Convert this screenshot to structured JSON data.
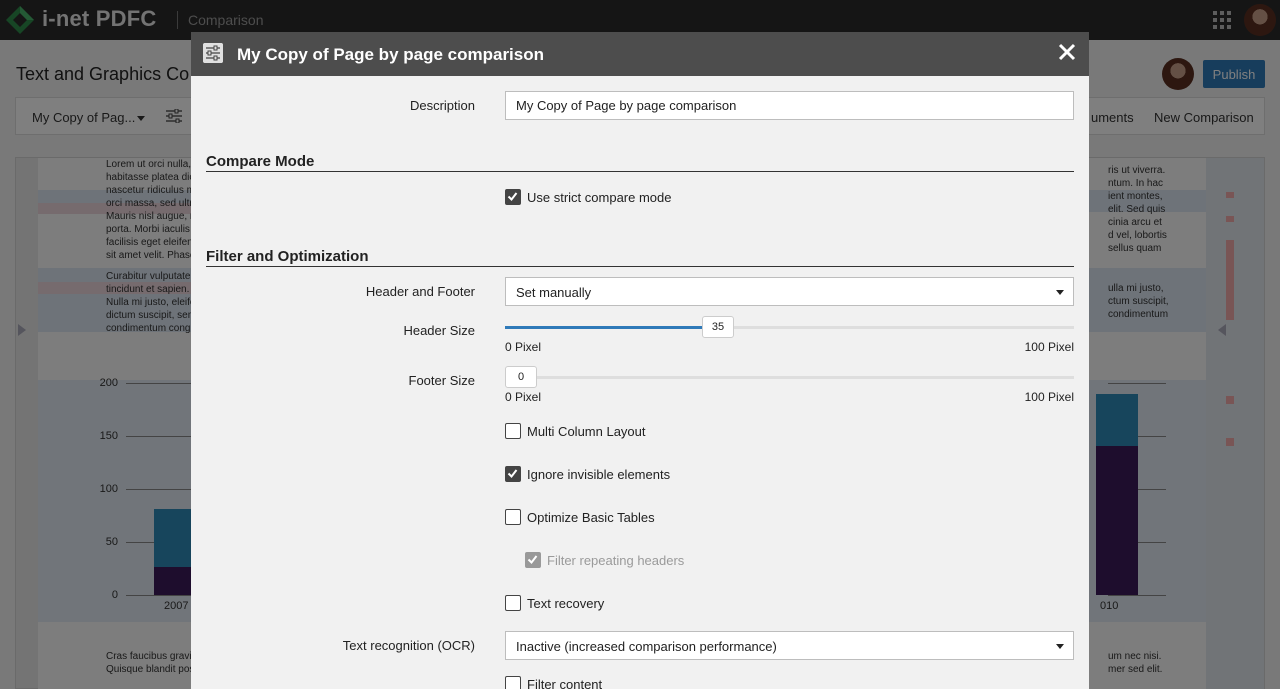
{
  "topbar": {
    "brand": "i-net PDFC",
    "app_name": "Comparison"
  },
  "page": {
    "title": "Text and Graphics Co",
    "publish_label": "Publish",
    "toolbar": {
      "compare_name": "My Copy of Pag...",
      "documents_label": "uments",
      "new_comparison_label": "New Comparison"
    },
    "document": {
      "left_lines": [
        "Lorem ut orci nulla,",
        "habitasse platea dic",
        "nascetur ridiculus mu",
        "orci massa, sed ultri",
        "Mauris nisl augue, rho",
        "porta. Morbi iaculis la",
        "facilisis eget eleifend",
        "sit amet velit. Phasellu"
      ],
      "left_lines_2": [
        "Curabitur vulputate h",
        "tincidunt et sapien. Fo",
        "Nulla mi justo, eleifen",
        "dictum suscipit, sem",
        "condimentum congue"
      ],
      "right_lines": [
        "ris ut viverra.",
        "ntum. In hac",
        "ient montes,",
        "elit. Sed quis",
        "cinia arcu et",
        "d vel, lobortis",
        "sellus quam"
      ],
      "right_lines_2": [
        "ulla mi justo,",
        "ctum suscipit,",
        "condimentum"
      ],
      "bottom_left_lines": [
        "Cras faucibus gravid",
        "Quisque blandit posu"
      ],
      "bottom_right_lines": [
        "um nec nisi.",
        "mer sed elit."
      ]
    },
    "chart": {
      "y_ticks": [
        "200",
        "150",
        "100",
        "50",
        "0"
      ],
      "x_ticks": [
        "2007",
        "010"
      ]
    }
  },
  "modal": {
    "title": "My Copy of Page by page comparison",
    "description": {
      "label": "Description",
      "value": "My Copy of Page by page comparison"
    },
    "compare_mode": {
      "title": "Compare Mode",
      "strict_label": "Use strict compare mode",
      "strict_checked": true
    },
    "filter": {
      "title": "Filter and Optimization",
      "header_footer_label": "Header and Footer",
      "header_footer_value": "Set manually",
      "header_size_label": "Header Size",
      "header_size_value": "35",
      "header_size_fraction": 0.35,
      "footer_size_label": "Footer Size",
      "footer_size_value": "0",
      "footer_size_fraction": 0,
      "min_label": "0 Pixel",
      "max_label": "100 Pixel",
      "multi_column_label": "Multi Column Layout",
      "multi_column_checked": false,
      "ignore_invisible_label": "Ignore invisible elements",
      "ignore_invisible_checked": true,
      "optimize_tables_label": "Optimize Basic Tables",
      "optimize_tables_checked": false,
      "filter_repeating_label": "Filter repeating headers",
      "filter_repeating_checked": true,
      "text_recovery_label": "Text recovery",
      "text_recovery_checked": false,
      "ocr_label": "Text recognition (OCR)",
      "ocr_value": "Inactive (increased comparison performance)",
      "filter_content_label": "Filter content",
      "filter_content_checked": false
    }
  },
  "colors": {
    "accent": "#2f7ab9",
    "modal_header": "#4d4d4d",
    "topbar": "#2b2b2b",
    "bar_top": "#2e8ab8",
    "bar_bottom": "#3c1a5b"
  }
}
